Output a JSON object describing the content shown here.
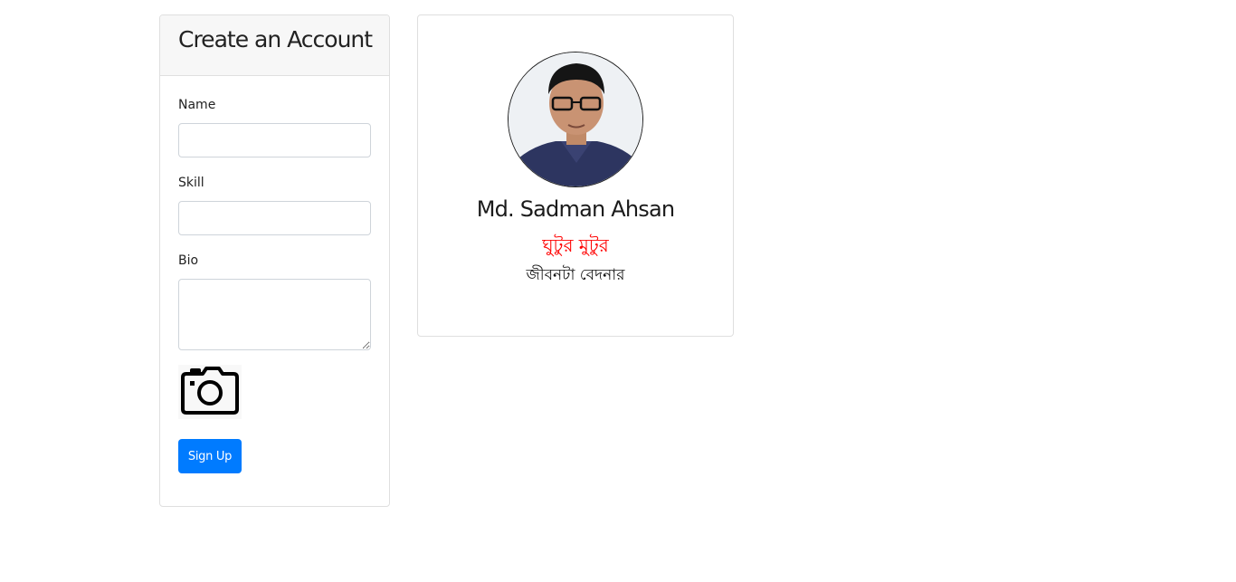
{
  "form": {
    "title": "Create an Account",
    "fields": {
      "name_label": "Name",
      "name_value": "",
      "skill_label": "Skill",
      "skill_value": "",
      "bio_label": "Bio",
      "bio_value": ""
    },
    "photo_icon": "camera-icon",
    "submit_label": "Sign Up"
  },
  "profile": {
    "name": "Md. Sadman Ahsan",
    "skill": "ঘুটুর মুটুর",
    "bio": "জীবনটা বেদনার",
    "skill_color": "#ff0000"
  },
  "colors": {
    "primary": "#007bff",
    "card_border": "#dfdfdf",
    "header_bg": "#f7f7f7"
  }
}
